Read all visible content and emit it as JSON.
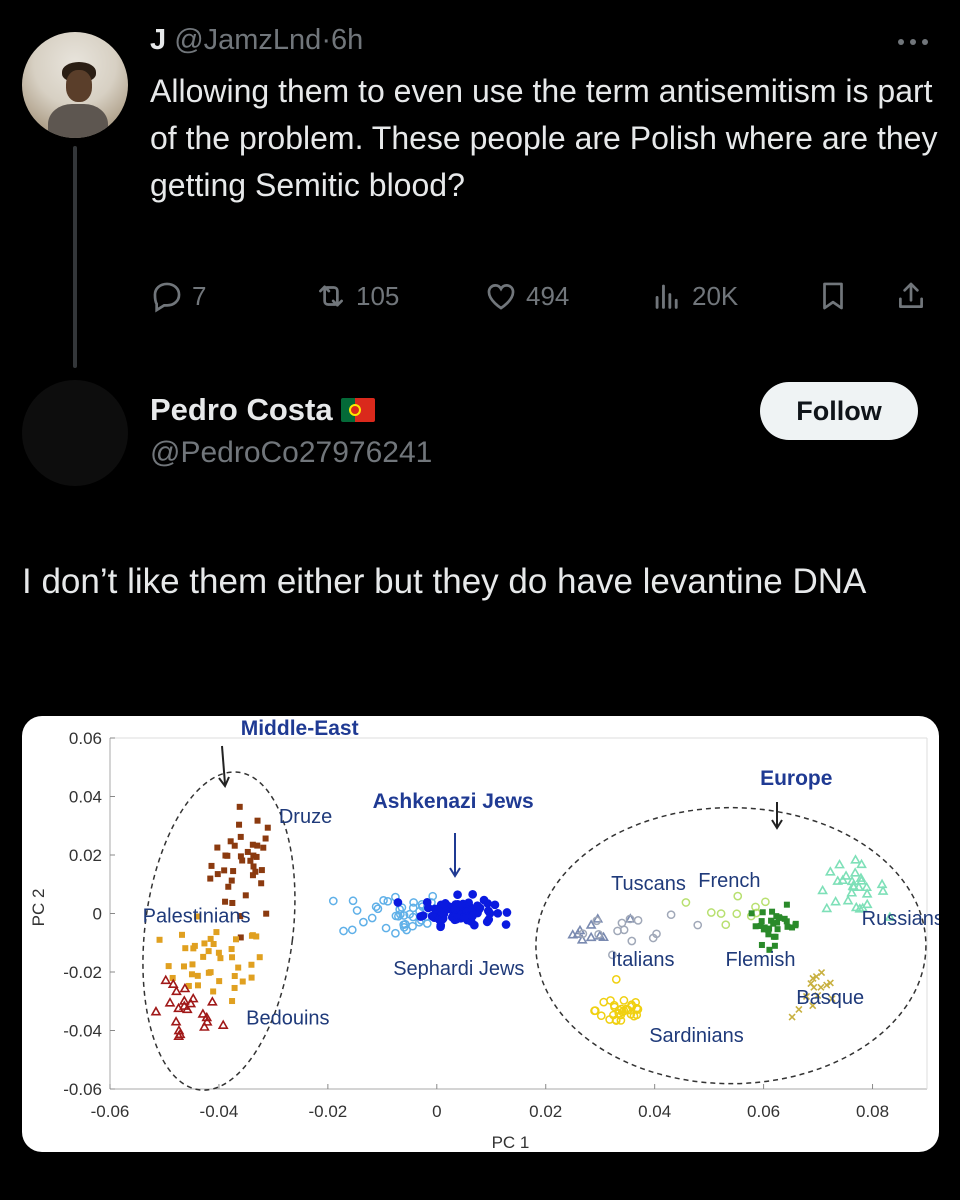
{
  "tweet1": {
    "display_name": "J",
    "handle": "@JamzLnd",
    "separator": "·",
    "time": "6h",
    "text": "Allowing them to even use the term antisemitism is part of the problem. These people are Polish where are they getting Semitic blood?",
    "stats": {
      "replies": "7",
      "reposts": "105",
      "likes": "494",
      "views": "20K"
    }
  },
  "tweet2": {
    "display_name": "Pedro Costa",
    "handle": "@PedroCo27976241",
    "follow_label": "Follow",
    "text": "I don’t like them either but they do have levantine DNA"
  },
  "chart_data": {
    "type": "scatter",
    "xlabel": "PC 1",
    "ylabel": "PC 2",
    "xlim": [
      -0.06,
      0.09
    ],
    "ylim": [
      -0.06,
      0.06
    ],
    "x_ticks": [
      "-0.06",
      "-0.04",
      "-0.02",
      "0",
      "0.02",
      "0.04",
      "0.06",
      "0.08"
    ],
    "x_tick_values": [
      -0.06,
      -0.04,
      -0.02,
      0,
      0.02,
      0.04,
      0.06,
      0.08
    ],
    "y_ticks": [
      "0.06",
      "0.04",
      "0.02",
      "0",
      "-0.02",
      "-0.04",
      "-0.06"
    ],
    "y_tick_values": [
      0.06,
      0.04,
      0.02,
      0,
      -0.02,
      -0.04,
      -0.06
    ],
    "region_labels": [
      {
        "text": "Middle-East",
        "x": -0.036,
        "y": 0.061,
        "color": "#1f3a93"
      },
      {
        "text": "Ashkenazi Jews",
        "x": 0.003,
        "y": 0.036,
        "color": "#1f3a93"
      },
      {
        "text": "Europe",
        "x": 0.066,
        "y": 0.044,
        "color": "#1f3a93"
      }
    ],
    "series": [
      {
        "name": "Druze",
        "color": "#8b3a0f",
        "shape": "square",
        "cx": -0.035,
        "cy": 0.017,
        "sx": 0.004,
        "sy": 0.012,
        "n": 38,
        "label": {
          "text": "Druze",
          "x": -0.029,
          "y": 0.031
        }
      },
      {
        "name": "Palestinians",
        "color": "#e0a020",
        "shape": "square",
        "cx": -0.041,
        "cy": -0.017,
        "sx": 0.006,
        "sy": 0.008,
        "n": 40,
        "label": {
          "text": "Palestinians",
          "x": -0.054,
          "y": -0.003
        }
      },
      {
        "name": "Bedouins",
        "color": "#a01818",
        "shape": "triangle",
        "cx": -0.046,
        "cy": -0.035,
        "sx": 0.004,
        "sy": 0.007,
        "n": 22,
        "label": {
          "text": "Bedouins",
          "x": -0.035,
          "y": -0.038
        }
      },
      {
        "name": "Sephardi Jews",
        "color": "#5fb0e8",
        "shape": "circle",
        "cx": -0.008,
        "cy": 0.0,
        "sx": 0.006,
        "sy": 0.005,
        "n": 40,
        "label": {
          "text": "Sephardi Jews",
          "x": -0.008,
          "y": -0.021
        }
      },
      {
        "name": "Ashkenazi Jews",
        "color": "#0a1ae0",
        "shape": "circle",
        "cx": 0.004,
        "cy": 0.001,
        "sx": 0.004,
        "sy": 0.003,
        "n": 90,
        "label": {
          "text": "",
          "x": 0,
          "y": 0
        }
      },
      {
        "name": "Tuscans",
        "color": "#7a8ab0",
        "shape": "triangle",
        "cx": 0.029,
        "cy": -0.006,
        "sx": 0.004,
        "sy": 0.003,
        "n": 10,
        "label": {
          "text": "Tuscans",
          "x": 0.032,
          "y": 0.008
        }
      },
      {
        "name": "French",
        "color": "#b8e070",
        "shape": "circle",
        "cx": 0.055,
        "cy": 0.003,
        "sx": 0.004,
        "sy": 0.004,
        "n": 10,
        "label": {
          "text": "French",
          "x": 0.048,
          "y": 0.009
        }
      },
      {
        "name": "Italians",
        "color": "#a0a8b8",
        "shape": "circle",
        "cx": 0.038,
        "cy": -0.006,
        "sx": 0.007,
        "sy": 0.003,
        "n": 14,
        "label": {
          "text": "Italians",
          "x": 0.032,
          "y": -0.018
        }
      },
      {
        "name": "Flemish",
        "color": "#2a8a2a",
        "shape": "square",
        "cx": 0.062,
        "cy": -0.004,
        "sx": 0.003,
        "sy": 0.004,
        "n": 30,
        "label": {
          "text": "Flemish",
          "x": 0.053,
          "y": -0.018
        }
      },
      {
        "name": "Russians",
        "color": "#7ee0b8",
        "shape": "triangle",
        "cx": 0.076,
        "cy": 0.009,
        "sx": 0.004,
        "sy": 0.005,
        "n": 28,
        "label": {
          "text": "Russians",
          "x": 0.078,
          "y": -0.004
        }
      },
      {
        "name": "Basque",
        "color": "#c8b040",
        "shape": "cross",
        "cx": 0.07,
        "cy": -0.028,
        "sx": 0.003,
        "sy": 0.005,
        "n": 14,
        "label": {
          "text": "Basque",
          "x": 0.066,
          "y": -0.031
        }
      },
      {
        "name": "Sardinians",
        "color": "#f0d010",
        "shape": "circle",
        "cx": 0.034,
        "cy": -0.033,
        "sx": 0.003,
        "sy": 0.004,
        "n": 32,
        "label": {
          "text": "Sardinians",
          "x": 0.039,
          "y": -0.044
        }
      }
    ]
  }
}
